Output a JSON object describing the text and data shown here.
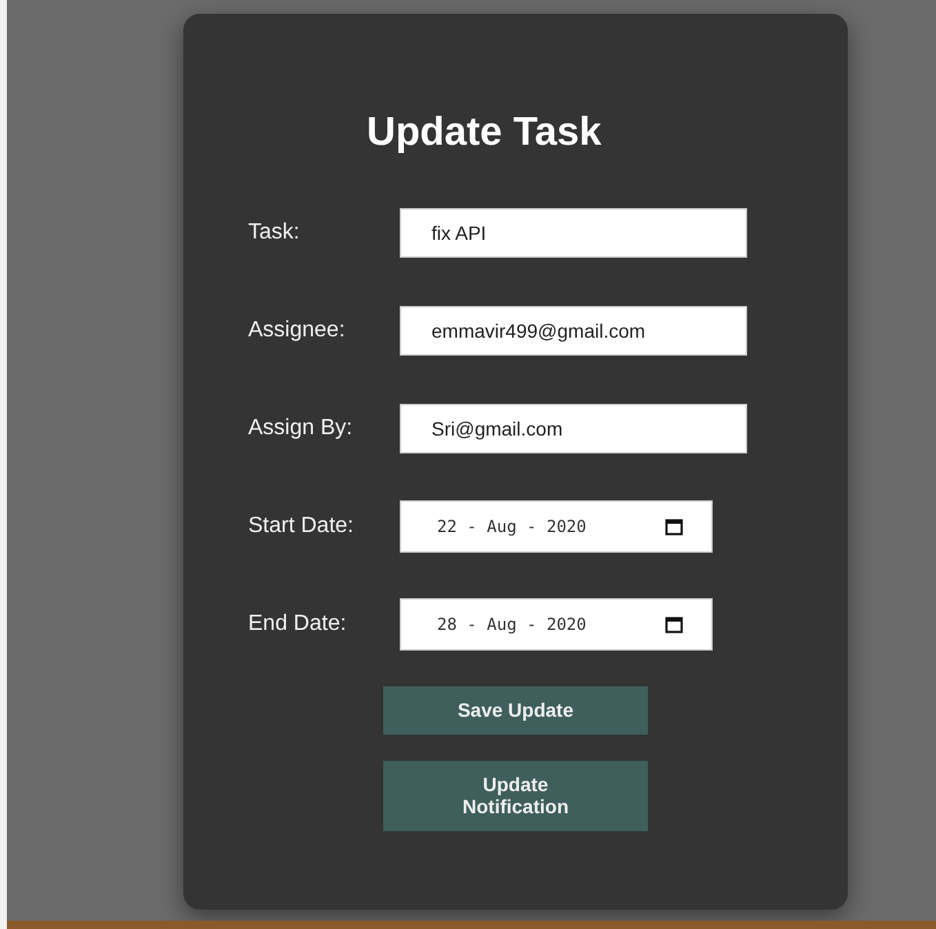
{
  "title": "Update Task",
  "fields": [
    {
      "kind": "text",
      "label": "Task:",
      "value": "fix API"
    },
    {
      "kind": "text",
      "label": "Assignee:",
      "value": "emmavir499@gmail.com"
    },
    {
      "kind": "text",
      "label": "Assign By:",
      "value": "Sri@gmail.com"
    },
    {
      "kind": "date",
      "label": "Start Date:",
      "value": "22 - Aug - 2020"
    },
    {
      "kind": "date",
      "label": "End Date:",
      "value": "28 - Aug - 2020"
    }
  ],
  "buttons": [
    "Save Update",
    "Update Notification"
  ]
}
